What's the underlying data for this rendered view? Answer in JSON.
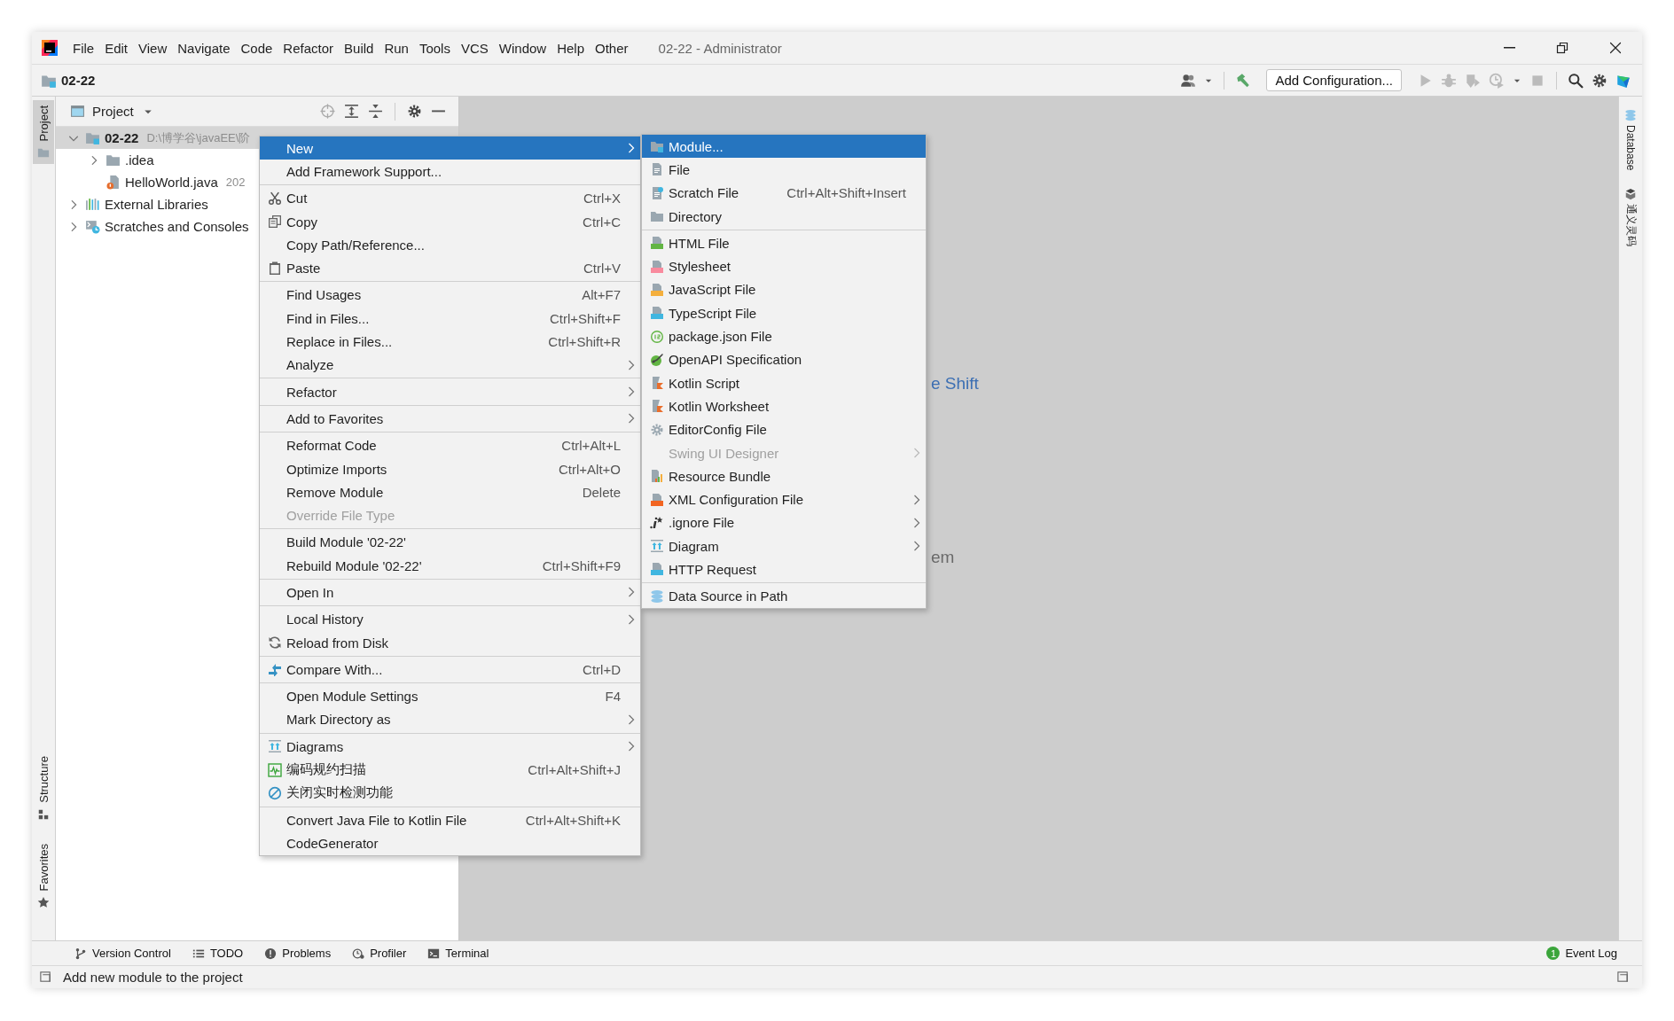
{
  "title_bar": {
    "menu": [
      "File",
      "Edit",
      "View",
      "Navigate",
      "Code",
      "Refactor",
      "Build",
      "Run",
      "Tools",
      "VCS",
      "Window",
      "Help",
      "Other"
    ],
    "title": "02-22 - Administrator"
  },
  "nav_bar": {
    "project": "02-22",
    "run_config": "Add Configuration..."
  },
  "left_strip": {
    "top": [
      {
        "label": "Project",
        "selected": true
      }
    ],
    "bottom": [
      {
        "label": "Structure",
        "selected": false
      },
      {
        "label": "Favorites",
        "selected": false
      }
    ]
  },
  "right_strip": [
    {
      "label": "Database"
    },
    {
      "label": "通义灵码"
    }
  ],
  "project_panel": {
    "title": "Project",
    "tree": [
      {
        "label": "02-22",
        "path": "D:\\博学谷\\javaEE\\阶",
        "kind": "module",
        "expanded": true,
        "selected": true,
        "children": [
          {
            "label": ".idea",
            "kind": "folder",
            "expanded": false,
            "selected": false
          },
          {
            "label": "HelloWorld.java",
            "meta": "202",
            "kind": "java",
            "selected": false
          }
        ]
      },
      {
        "label": "External Libraries",
        "kind": "libraries",
        "expanded": false,
        "selected": false
      },
      {
        "label": "Scratches and Consoles",
        "kind": "scratches",
        "expanded": false,
        "selected": false
      }
    ]
  },
  "editor": {
    "hints": [
      {
        "text": "e Shift",
        "kind": "shortcut"
      },
      {
        "text": "em",
        "kind": "plain"
      }
    ]
  },
  "context_menu": {
    "groups": [
      [
        {
          "label": "New",
          "submenu": true,
          "disabled": false,
          "selected": true
        },
        {
          "label": "Add Framework Support...",
          "submenu": false,
          "disabled": false,
          "selected": false
        }
      ],
      [
        {
          "label": "Cut",
          "shortcut": "Ctrl+X",
          "submenu": false,
          "disabled": false,
          "selected": false
        },
        {
          "label": "Copy",
          "shortcut": "Ctrl+C",
          "submenu": false,
          "disabled": false,
          "selected": false
        },
        {
          "label": "Copy Path/Reference...",
          "submenu": false,
          "disabled": false,
          "selected": false
        },
        {
          "label": "Paste",
          "shortcut": "Ctrl+V",
          "submenu": false,
          "disabled": false,
          "selected": false
        }
      ],
      [
        {
          "label": "Find Usages",
          "shortcut": "Alt+F7",
          "submenu": false,
          "disabled": false,
          "selected": false
        },
        {
          "label": "Find in Files...",
          "shortcut": "Ctrl+Shift+F",
          "submenu": false,
          "disabled": false,
          "selected": false
        },
        {
          "label": "Replace in Files...",
          "shortcut": "Ctrl+Shift+R",
          "submenu": false,
          "disabled": false,
          "selected": false
        },
        {
          "label": "Analyze",
          "submenu": true,
          "disabled": false,
          "selected": false
        }
      ],
      [
        {
          "label": "Refactor",
          "submenu": true,
          "disabled": false,
          "selected": false
        }
      ],
      [
        {
          "label": "Add to Favorites",
          "submenu": true,
          "disabled": false,
          "selected": false
        }
      ],
      [
        {
          "label": "Reformat Code",
          "shortcut": "Ctrl+Alt+L",
          "submenu": false,
          "disabled": false,
          "selected": false
        },
        {
          "label": "Optimize Imports",
          "shortcut": "Ctrl+Alt+O",
          "submenu": false,
          "disabled": false,
          "selected": false
        },
        {
          "label": "Remove Module",
          "shortcut": "Delete",
          "submenu": false,
          "disabled": false,
          "selected": false
        },
        {
          "label": "Override File Type",
          "submenu": false,
          "disabled": true,
          "selected": false
        }
      ],
      [
        {
          "label": "Build Module '02-22'",
          "submenu": false,
          "disabled": false,
          "selected": false
        },
        {
          "label": "Rebuild Module '02-22'",
          "shortcut": "Ctrl+Shift+F9",
          "submenu": false,
          "disabled": false,
          "selected": false
        }
      ],
      [
        {
          "label": "Open In",
          "submenu": true,
          "disabled": false,
          "selected": false
        }
      ],
      [
        {
          "label": "Local History",
          "submenu": true,
          "disabled": false,
          "selected": false
        },
        {
          "label": "Reload from Disk",
          "submenu": false,
          "disabled": false,
          "selected": false
        }
      ],
      [
        {
          "label": "Compare With...",
          "shortcut": "Ctrl+D",
          "submenu": false,
          "disabled": false,
          "selected": false
        }
      ],
      [
        {
          "label": "Open Module Settings",
          "shortcut": "F4",
          "submenu": false,
          "disabled": false,
          "selected": false
        },
        {
          "label": "Mark Directory as",
          "submenu": true,
          "disabled": false,
          "selected": false
        }
      ],
      [
        {
          "label": "Diagrams",
          "submenu": true,
          "disabled": false,
          "selected": false
        },
        {
          "label": "编码规约扫描",
          "shortcut": "Ctrl+Alt+Shift+J",
          "submenu": false,
          "disabled": false,
          "selected": false
        },
        {
          "label": "关闭实时检测功能",
          "submenu": false,
          "disabled": false,
          "selected": false
        }
      ],
      [
        {
          "label": "Convert Java File to Kotlin File",
          "shortcut": "Ctrl+Alt+Shift+K",
          "submenu": false,
          "disabled": false,
          "selected": false
        },
        {
          "label": "CodeGenerator",
          "submenu": false,
          "disabled": false,
          "selected": false
        }
      ]
    ]
  },
  "submenu": {
    "groups": [
      [
        {
          "label": "Module...",
          "submenu": false,
          "disabled": false,
          "selected": true
        },
        {
          "label": "File",
          "submenu": false,
          "disabled": false,
          "selected": false
        },
        {
          "label": "Scratch File",
          "shortcut": "Ctrl+Alt+Shift+Insert",
          "submenu": false,
          "disabled": false,
          "selected": false
        },
        {
          "label": "Directory",
          "submenu": false,
          "disabled": false,
          "selected": false
        }
      ],
      [
        {
          "label": "HTML File",
          "submenu": false,
          "disabled": false,
          "selected": false
        },
        {
          "label": "Stylesheet",
          "submenu": false,
          "disabled": false,
          "selected": false
        },
        {
          "label": "JavaScript File",
          "submenu": false,
          "disabled": false,
          "selected": false
        },
        {
          "label": "TypeScript File",
          "submenu": false,
          "disabled": false,
          "selected": false
        },
        {
          "label": "package.json File",
          "submenu": false,
          "disabled": false,
          "selected": false
        },
        {
          "label": "OpenAPI Specification",
          "submenu": false,
          "disabled": false,
          "selected": false
        },
        {
          "label": "Kotlin Script",
          "submenu": false,
          "disabled": false,
          "selected": false
        },
        {
          "label": "Kotlin Worksheet",
          "submenu": false,
          "disabled": false,
          "selected": false
        },
        {
          "label": "EditorConfig File",
          "submenu": false,
          "disabled": false,
          "selected": false
        },
        {
          "label": "Swing UI Designer",
          "submenu": true,
          "disabled": true,
          "selected": false
        },
        {
          "label": "Resource Bundle",
          "submenu": false,
          "disabled": false,
          "selected": false
        },
        {
          "label": "XML Configuration File",
          "submenu": true,
          "disabled": false,
          "selected": false
        },
        {
          "label": ".ignore File",
          "submenu": true,
          "disabled": false,
          "selected": false
        },
        {
          "label": "Diagram",
          "submenu": true,
          "disabled": false,
          "selected": false
        },
        {
          "label": "HTTP Request",
          "submenu": false,
          "disabled": false,
          "selected": false
        }
      ],
      [
        {
          "label": "Data Source in Path",
          "submenu": false,
          "disabled": false,
          "selected": false
        }
      ]
    ]
  },
  "tool_tabs": [
    "Version Control",
    "TODO",
    "Problems",
    "Profiler",
    "Terminal"
  ],
  "event_log": {
    "label": "Event Log",
    "count": "1"
  },
  "status_bar": {
    "message": "Add new module to the project"
  }
}
